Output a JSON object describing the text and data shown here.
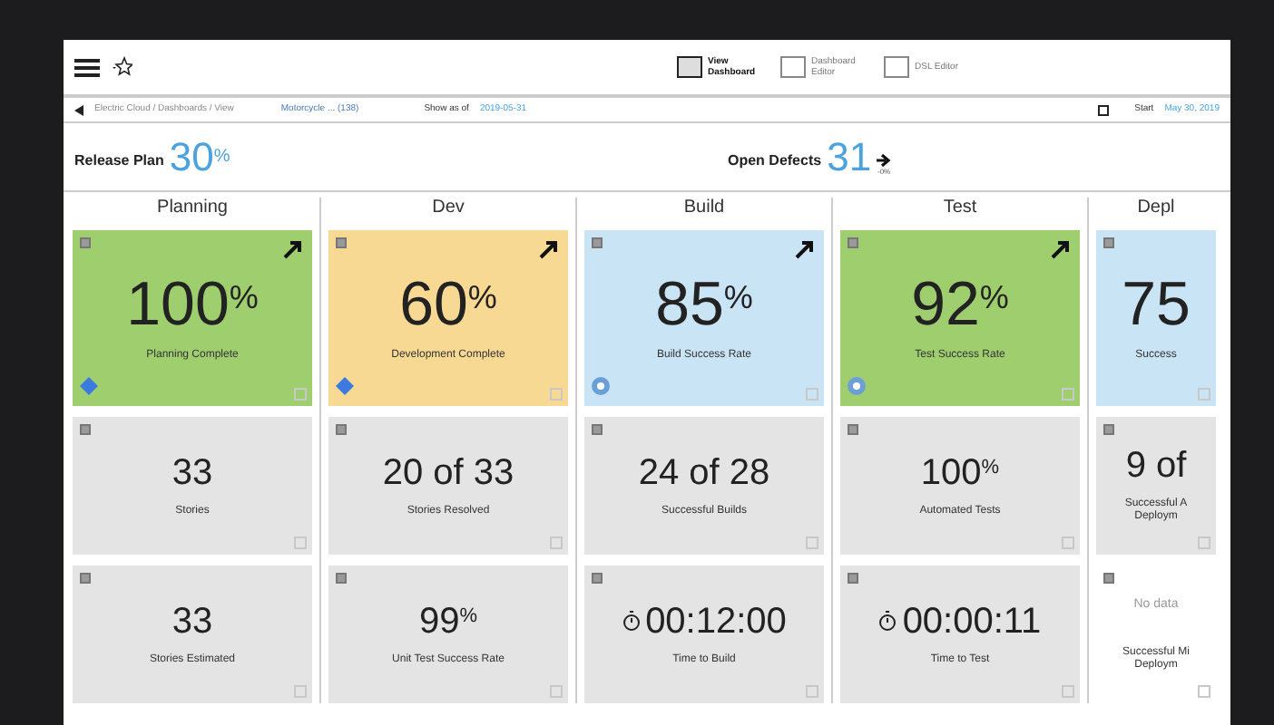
{
  "toolbar": {
    "views": [
      {
        "label": "View Dashboard",
        "selected": true
      },
      {
        "label": "Dashboard Editor",
        "selected": false
      },
      {
        "label": "DSL Editor",
        "selected": false
      }
    ]
  },
  "breadcrumb": {
    "path": "Electric Cloud / Dashboards / View",
    "release": "Motorcycle ... (138)",
    "show_as_of": "Show as of",
    "date": "2019-05-31",
    "start_label": "Start",
    "start_date": "May 30, 2019"
  },
  "kpis": [
    {
      "label": "Release Plan",
      "value": "30",
      "unit": "%"
    },
    {
      "label": "Open Defects",
      "value": "31",
      "change": "-0%"
    }
  ],
  "columns": [
    {
      "title": "Planning",
      "cards": [
        {
          "kind": "percent",
          "value": "100",
          "unit": "%",
          "label": "Planning Complete",
          "color": "#9fce6e",
          "trend": true,
          "logo": {
            "kind": "diamond"
          }
        },
        {
          "kind": "count",
          "value": "33",
          "label": "Stories"
        },
        {
          "kind": "count",
          "value": "33",
          "label": "Stories Estimated"
        }
      ]
    },
    {
      "title": "Dev",
      "cards": [
        {
          "kind": "percent",
          "value": "60",
          "unit": "%",
          "label": "Development Complete",
          "color": "#f8d993",
          "trend": true,
          "logo": {
            "kind": "diamond"
          }
        },
        {
          "kind": "count",
          "value": "20 of 33",
          "label": "Stories Resolved"
        },
        {
          "kind": "percent",
          "value": "99",
          "unit": "%",
          "label": "Unit Test Success Rate"
        }
      ]
    },
    {
      "title": "Build",
      "cards": [
        {
          "kind": "percent",
          "value": "85",
          "unit": "%",
          "label": "Build Success Rate",
          "color": "#c9e4f4",
          "trend": true,
          "logo": {
            "kind": "round"
          }
        },
        {
          "kind": "count",
          "value": "24 of 28",
          "label": "Successful Builds"
        },
        {
          "kind": "timer",
          "value": "00:12:00",
          "label": "Time to Build"
        }
      ]
    },
    {
      "title": "Test",
      "cards": [
        {
          "kind": "percent",
          "value": "92",
          "unit": "%",
          "label": "Test Success Rate",
          "color": "#9fce6e",
          "trend": true,
          "logo": {
            "kind": "round"
          }
        },
        {
          "kind": "percent",
          "value": "100",
          "unit": "%",
          "label": "Automated Tests"
        },
        {
          "kind": "timer",
          "value": "00:00:11",
          "label": "Time to Test"
        }
      ]
    },
    {
      "title": "Depl",
      "cards": [
        {
          "kind": "count",
          "value": "75",
          "label": "Success",
          "color": "#c9e4f4",
          "trend": false
        },
        {
          "kind": "count",
          "value": "9 of",
          "label": "Successful A\nDeploym"
        },
        {
          "kind": "empty",
          "value": "No data",
          "label": "Successful Mi\nDeploym"
        }
      ]
    }
  ]
}
